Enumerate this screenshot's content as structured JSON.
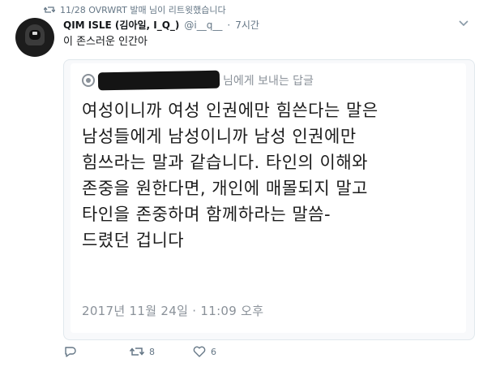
{
  "retweet": {
    "text": "11/28 OVRWRT 발매 님이 리트윗했습니다",
    "icon": "retweet-icon"
  },
  "tweet": {
    "display_name": "QIM ISLE (김아일, I_Q_)",
    "handle": "@i__q__",
    "separator": "·",
    "time": "7시간",
    "text": "이 존스러운 인간아"
  },
  "media": {
    "reply_to_suffix": "님에게 보내는 답글",
    "lines": [
      "여성이니까 여성 인권에만 힘쓴다는 말은",
      "남성들에게 남성이니까 남성 인권에만",
      "힘쓰라는 말과 같습니다. 타인의 이해와",
      "존중을 원한다면, 개인에 매몰되지 말고",
      "타인을 존중하며 함께하라는 말씀-",
      "드렸던 겁니다"
    ],
    "date": "2017년 11월 24일 · 11:09 오후"
  },
  "actions": {
    "reply": {
      "icon": "reply-icon",
      "count": ""
    },
    "retweet": {
      "icon": "retweet-icon",
      "count": "8"
    },
    "like": {
      "icon": "heart-icon",
      "count": "6"
    }
  },
  "colors": {
    "secondary_text": "#657786",
    "border": "#e1e8ed",
    "primary_text": "#14171a"
  }
}
